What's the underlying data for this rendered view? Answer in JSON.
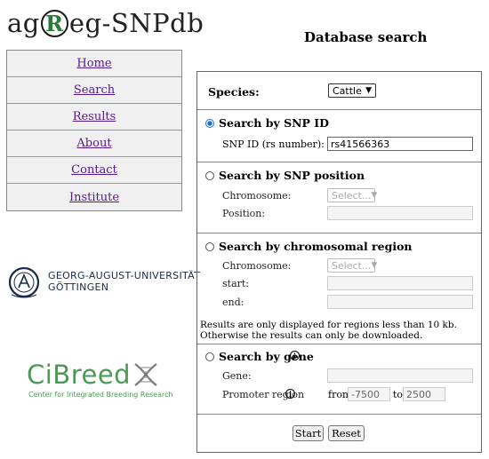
{
  "logo": {
    "prefix": "ag",
    "circle_letter": "R",
    "suffix": "eg-SNPdb"
  },
  "nav": {
    "items": [
      "Home",
      "Search",
      "Results",
      "About",
      "Contact",
      "Institute"
    ]
  },
  "university": {
    "line1": "GEORG-AUGUST-UNIVERSITÄT",
    "line2": "GÖTTINGEN"
  },
  "cibreed": {
    "title": "CiBreed",
    "subtitle": "Center for Integrated Breeding Research"
  },
  "page": {
    "title": "Database search"
  },
  "species": {
    "label": "Species:",
    "value": "Cattle"
  },
  "snpid": {
    "title": "Search by SNP ID",
    "field_label": "SNP ID (rs number):",
    "value": "rs41566363",
    "selected": true
  },
  "snppos": {
    "title": "Search by SNP position",
    "chrom_label": "Chromosome:",
    "chrom_placeholder": "Select...",
    "pos_label": "Position:"
  },
  "region": {
    "title": "Search by chromosomal region",
    "chrom_label": "Chromosome:",
    "chrom_placeholder": "Select...",
    "start_label": "start:",
    "end_label": "end:",
    "note_line1": "Results are only displayed for regions less than 10 kb.",
    "note_line2": "Otherwise the results can only be downloaded."
  },
  "gene": {
    "title": "Search by gene",
    "gene_label": "Gene:",
    "promoter_label": "Promoter region",
    "from_label": "from",
    "from_value": "-7500",
    "to_label": "to",
    "to_value": "2500"
  },
  "buttons": {
    "start": "Start",
    "reset": "Reset"
  },
  "icons": {
    "info": "info-icon",
    "dropdown": "chevron-down-icon"
  }
}
